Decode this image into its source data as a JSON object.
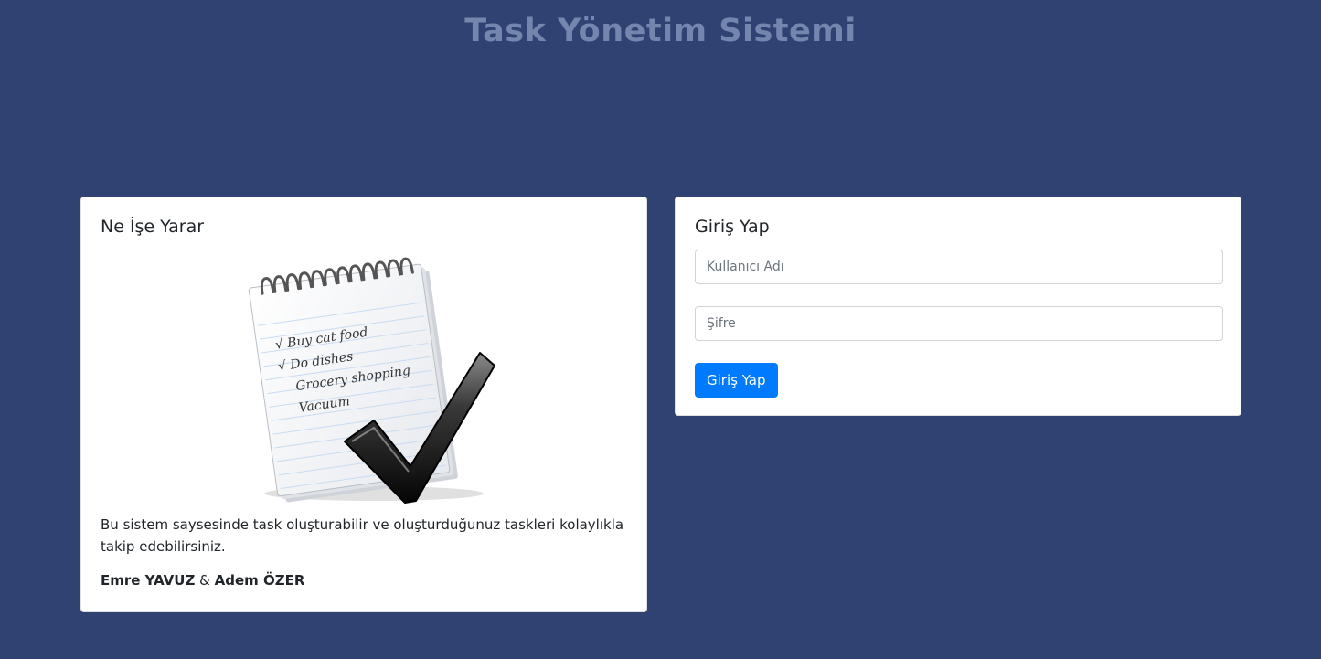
{
  "header": {
    "title": "Task Yönetim Sistemi"
  },
  "info_card": {
    "title": "Ne İşe Yarar",
    "image": {
      "icon": "notepad-checkmark-illustration",
      "list_items": [
        "√ Buy cat food",
        "√ Do dishes",
        "Grocery shopping",
        "Vacuum"
      ]
    },
    "description": "Bu sistem saysesinde task oluşturabilir ve oluşturduğunuz taskleri kolaylıkla takip edebilirsiniz.",
    "authors": {
      "author1": "Emre YAVUZ",
      "separator": "&",
      "author2": "Adem ÖZER"
    }
  },
  "login_card": {
    "title": "Giriş Yap",
    "username_placeholder": "Kullanıcı Adı",
    "username_value": "",
    "password_placeholder": "Şifre",
    "password_value": "",
    "submit_label": "Giriş Yap"
  },
  "colors": {
    "background": "#2f4272",
    "title": "#7486ae",
    "button": "#007bff"
  }
}
